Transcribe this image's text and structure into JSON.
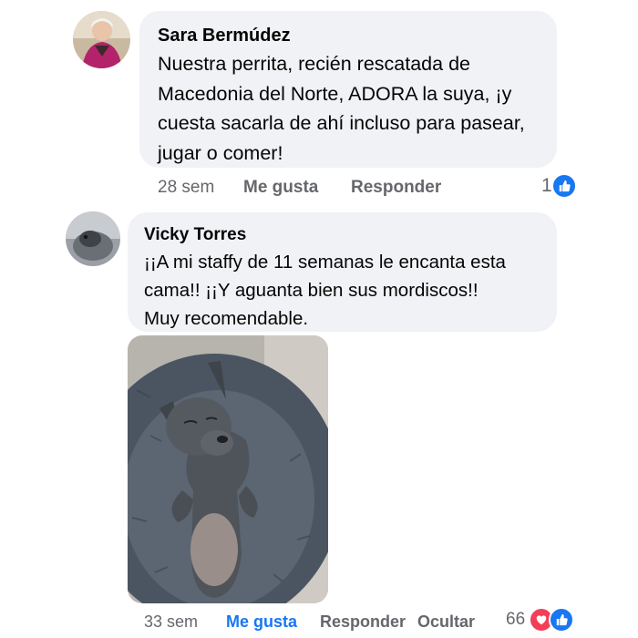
{
  "comments": [
    {
      "author": "Sara Bermúdez",
      "text": "Nuestra perrita, recién rescatada de\nMacedonia del Norte, ADORA la suya, ¡y\ncuesta sacarla de ahí incluso para pasear,\njugar o comer!",
      "time": "28 sem",
      "like_label": "Me gusta",
      "reply_label": "Responder",
      "reaction_count": "1",
      "reactions": [
        "like-icon"
      ]
    },
    {
      "author": "Vicky Torres",
      "text": "¡¡A mi staffy de 11 semanas le encanta esta\ncama!! ¡¡Y aguanta bien sus mordiscos!!\nMuy recomendable.",
      "time": "33 sem",
      "like_label": "Me gusta",
      "reply_label": "Responder",
      "hide_label": "Ocultar",
      "reaction_count": "66",
      "reactions": [
        "love-icon",
        "like-icon"
      ],
      "like_active_color": "#1877f2"
    }
  ],
  "colors": {
    "bubble": "#f0f2f5",
    "meta_text": "#65676b",
    "like_blue": "#1877f2",
    "love_red": "#f33e58"
  }
}
